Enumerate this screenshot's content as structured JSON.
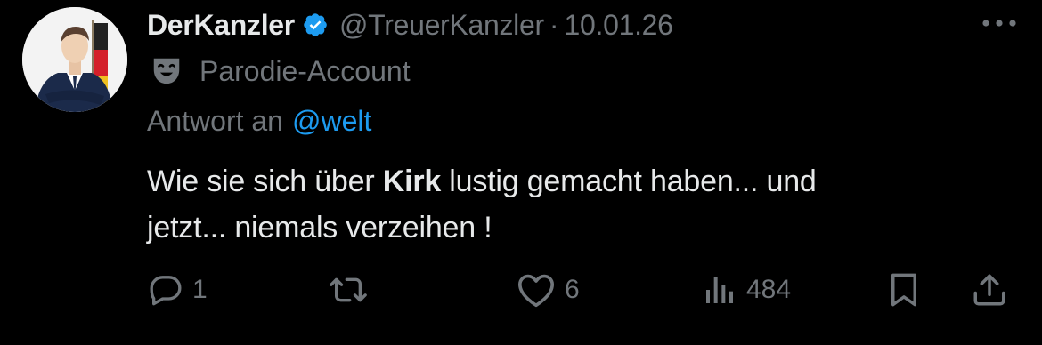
{
  "tweet": {
    "display_name": "DerKanzler",
    "handle": "@TreuerKanzler",
    "separator": "·",
    "date": "10.01.26",
    "parody_label": "Parodie-Account",
    "reply_prefix": "Antwort an",
    "reply_mention": "@welt",
    "body": {
      "part1": "Wie sie sich über ",
      "bold": "Kirk",
      "part2": " lustig gemacht haben... und",
      "line2": "jetzt... niemals verzeihen !"
    }
  },
  "actions": {
    "reply_count": "1",
    "repost_count": "",
    "like_count": "6",
    "view_count": "484"
  },
  "icons": {
    "avatar": "avatar-portrait",
    "verified": "verified-badge-icon",
    "parody": "theater-mask-icon",
    "more": "more-icon",
    "reply": "reply-icon",
    "repost": "repost-icon",
    "like": "heart-icon",
    "views": "views-icon",
    "bookmark": "bookmark-icon",
    "share": "share-icon"
  },
  "colors": {
    "background": "#000000",
    "text_primary": "#e7e9ea",
    "text_secondary": "#71767b",
    "link": "#1d9bf0"
  }
}
